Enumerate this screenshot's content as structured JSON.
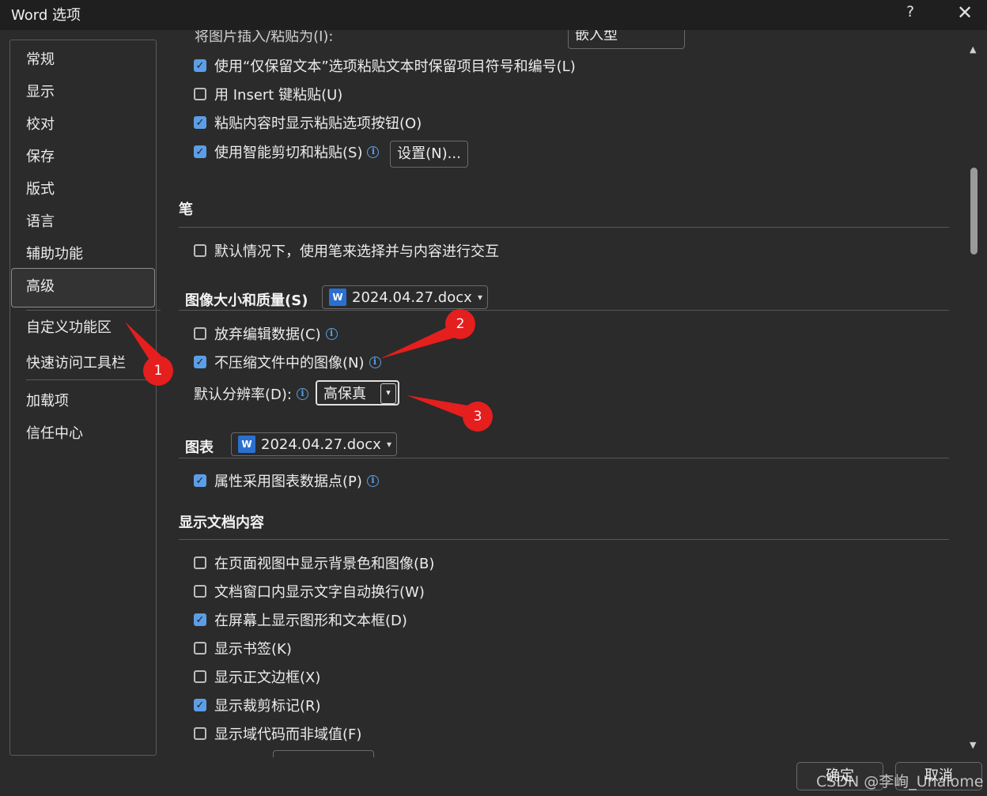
{
  "window": {
    "title": "Word 选项",
    "help": "?",
    "close": "✕"
  },
  "nav": {
    "items": [
      "常规",
      "显示",
      "校对",
      "保存",
      "版式",
      "语言",
      "辅助功能",
      "高级",
      "自定义功能区",
      "快速访问工具栏",
      "加载项",
      "信任中心"
    ],
    "selected": "高级"
  },
  "cut_paste": {
    "top_partial_label": "将图片插入/粘贴为(I):",
    "top_partial_value": "嵌入型",
    "opt1": {
      "label": "使用“仅保留文本”选项粘贴文本时保留项目符号和编号(L)",
      "checked": true
    },
    "opt2": {
      "label": "用 Insert 键粘贴(U)",
      "checked": false
    },
    "opt3": {
      "label": "粘贴内容时显示粘贴选项按钮(O)",
      "checked": true
    },
    "opt4": {
      "label": "使用智能剪切和粘贴(S)",
      "checked": true
    },
    "settings_button": "设置(N)..."
  },
  "pen": {
    "heading": "笔",
    "opt1": {
      "label": "默认情况下，使用笔来选择并与内容进行交互",
      "checked": false
    }
  },
  "image": {
    "heading": "图像大小和质量(S)",
    "doc": "2024.04.27.docx",
    "discard": {
      "label": "放弃编辑数据(C)",
      "checked": false
    },
    "nocompress": {
      "label": "不压缩文件中的图像(N)",
      "checked": true
    },
    "resolution_label": "默认分辨率(D):",
    "resolution_value": "高保真"
  },
  "chart": {
    "heading": "图表",
    "doc": "2024.04.27.docx",
    "opt1": {
      "label": "属性采用图表数据点(P)",
      "checked": true
    }
  },
  "display": {
    "heading": "显示文档内容",
    "opt1": {
      "label": "在页面视图中显示背景色和图像(B)",
      "checked": false
    },
    "opt2": {
      "label": "文档窗口内显示文字自动换行(W)",
      "checked": false
    },
    "opt3": {
      "label": "在屏幕上显示图形和文本框(D)",
      "checked": true
    },
    "opt4": {
      "label": "显示书签(K)",
      "checked": false
    },
    "opt5": {
      "label": "显示正文边框(X)",
      "checked": false
    },
    "opt6": {
      "label": "显示裁剪标记(R)",
      "checked": true
    },
    "opt7": {
      "label": "显示域代码而非域值(F)",
      "checked": false
    }
  },
  "callouts": [
    "1",
    "2",
    "3"
  ],
  "callout_color": "#e51e1e",
  "accent_color": "#5b9ee6",
  "footer": {
    "ok": "确定",
    "cancel": "取消"
  },
  "watermark": "CSDN @李峋_Unalome"
}
